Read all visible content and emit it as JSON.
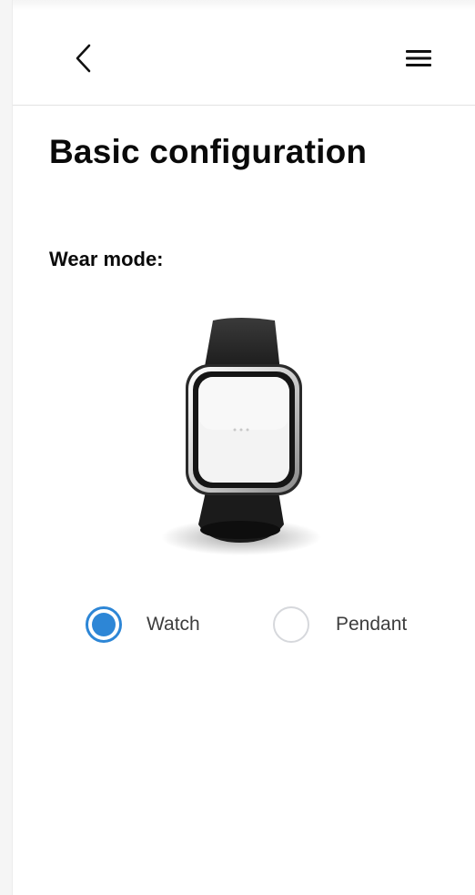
{
  "header": {
    "back_icon": "chevron-left-icon",
    "menu_icon": "hamburger-menu-icon"
  },
  "page": {
    "title": "Basic configuration"
  },
  "wear_mode": {
    "label": "Wear mode:",
    "image": "wristband-watch-device",
    "options": [
      {
        "label": "Watch",
        "selected": true
      },
      {
        "label": "Pendant",
        "selected": false
      }
    ]
  },
  "colors": {
    "accent": "#2d86d6",
    "title_text": "#0a0a0a",
    "option_text": "#3d3d3d",
    "unchecked_border": "#d6d8dc",
    "divider": "#e2e2e2"
  }
}
